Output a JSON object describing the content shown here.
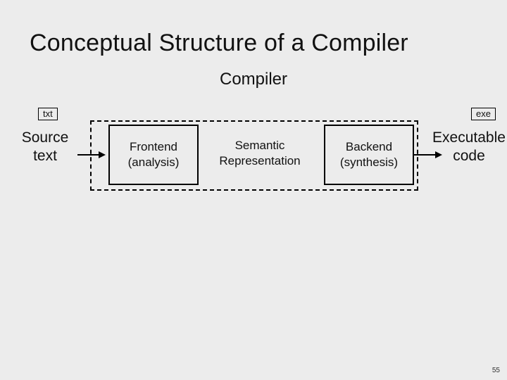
{
  "title": "Conceptual Structure of a Compiler",
  "subtitle": "Compiler",
  "tags": {
    "left": "txt",
    "right": "exe"
  },
  "left_block": {
    "l1": "Source",
    "l2": "text"
  },
  "right_block": {
    "l1": "Executable",
    "l2": "code"
  },
  "frontend": {
    "l1": "Frontend",
    "l2": "(analysis)"
  },
  "middle": {
    "l1": "Semantic",
    "l2": "Representation"
  },
  "backend": {
    "l1": "Backend",
    "l2": "(synthesis)"
  },
  "page_number": "55"
}
